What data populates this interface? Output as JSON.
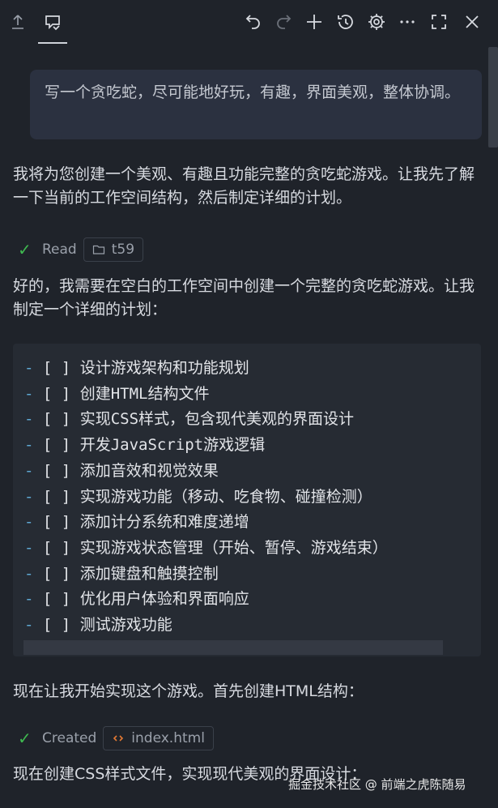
{
  "toolbar": {
    "icons": [
      "upload-icon",
      "chat-icon",
      "undo-icon",
      "redo-icon",
      "add-icon",
      "history-icon",
      "gear-icon",
      "more-icon",
      "fullscreen-icon",
      "close-icon"
    ]
  },
  "user_message": "写一个贪吃蛇，尽可能地好玩，有趣，界面美观，整体协调。",
  "para1": "我将为您创建一个美观、有趣且功能完整的贪吃蛇游戏。让我先了解一下当前的工作空间结构，然后制定详细的计划。",
  "read_tool": {
    "label": "Read",
    "target": "t59"
  },
  "para2": "好的，我需要在空白的工作空间中创建一个完整的贪吃蛇游戏。让我制定一个详细的计划：",
  "plan": [
    {
      "prefix": "-",
      "box": "[ ]",
      "text": "设计游戏架构和功能规划"
    },
    {
      "prefix": "-",
      "box": "[ ]",
      "text": "创建HTML结构文件"
    },
    {
      "prefix": "-",
      "box": "[ ]",
      "text": "实现CSS样式，包含现代美观的界面设计"
    },
    {
      "prefix": "-",
      "box": "[ ]",
      "text": "开发JavaScript游戏逻辑"
    },
    {
      "prefix": "-",
      "box": "[ ]",
      "text": "添加音效和视觉效果"
    },
    {
      "prefix": "-",
      "box": "[ ]",
      "text": "实现游戏功能（移动、吃食物、碰撞检测）"
    },
    {
      "prefix": "-",
      "box": "[ ]",
      "text": "添加计分系统和难度递增"
    },
    {
      "prefix": "-",
      "box": "[ ]",
      "text": "实现游戏状态管理（开始、暂停、游戏结束）"
    },
    {
      "prefix": "-",
      "box": "[ ]",
      "text": "添加键盘和触摸控制"
    },
    {
      "prefix": "-",
      "box": "[ ]",
      "text": "优化用户体验和界面响应"
    },
    {
      "prefix": "-",
      "box": "[ ]",
      "text": "测试游戏功能"
    }
  ],
  "para3": "现在让我开始实现这个游戏。首先创建HTML结构：",
  "created_tool": {
    "label": "Created",
    "target": "index.html"
  },
  "para4": "现在创建CSS样式文件，实现现代美观的界面设计：",
  "watermark": "掘金技术社区 @ 前端之虎陈随易",
  "colors": {
    "background": "#1f232a",
    "user_bubble": "#2b3140",
    "code_bg": "#262b33",
    "check": "#3fb950",
    "dash": "#5fa8d3",
    "html_icon": "#e37933"
  }
}
